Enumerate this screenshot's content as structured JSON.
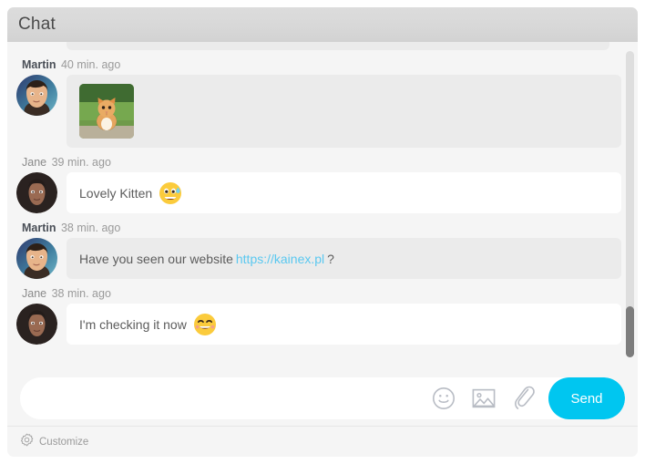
{
  "header": {
    "title": "Chat"
  },
  "messages": [
    {
      "name": "Martin",
      "time": "40 min. ago",
      "own": true,
      "bubble_style": "gray",
      "text": "",
      "attachment": "kitten-photo",
      "emoji": "",
      "avatar": "martin-avatar"
    },
    {
      "name": "Jane",
      "time": "39 min. ago",
      "own": false,
      "bubble_style": "white",
      "text": "Lovely Kitten",
      "attachment": "",
      "emoji": "grinning-face-with-sweat",
      "avatar": "jane-avatar"
    },
    {
      "name": "Martin",
      "time": "38 min. ago",
      "own": true,
      "bubble_style": "gray",
      "text_before_link": "Have you seen our website",
      "link_text": "https://kainex.pl",
      "text_after_link": "?",
      "attachment": "",
      "emoji": "",
      "avatar": "martin-avatar"
    },
    {
      "name": "Jane",
      "time": "38 min. ago",
      "own": false,
      "bubble_style": "white",
      "text": "I'm checking it now",
      "attachment": "",
      "emoji": "smiling-face-with-smiling-eyes",
      "avatar": "jane-avatar"
    }
  ],
  "composer": {
    "value": "",
    "placeholder": "",
    "emoji_icon": "smiley-icon",
    "image_icon": "image-icon",
    "attachment_icon": "paperclip-icon",
    "send_label": "Send"
  },
  "footer": {
    "customize_label": "Customize",
    "customize_icon": "gear-icon"
  },
  "colors": {
    "accent": "#00c6f0",
    "link": "#5ac8f0",
    "own_bubble": "#ebebeb",
    "other_bubble": "#ffffff",
    "background": "#f5f5f5",
    "header": "#d8d8d8"
  }
}
